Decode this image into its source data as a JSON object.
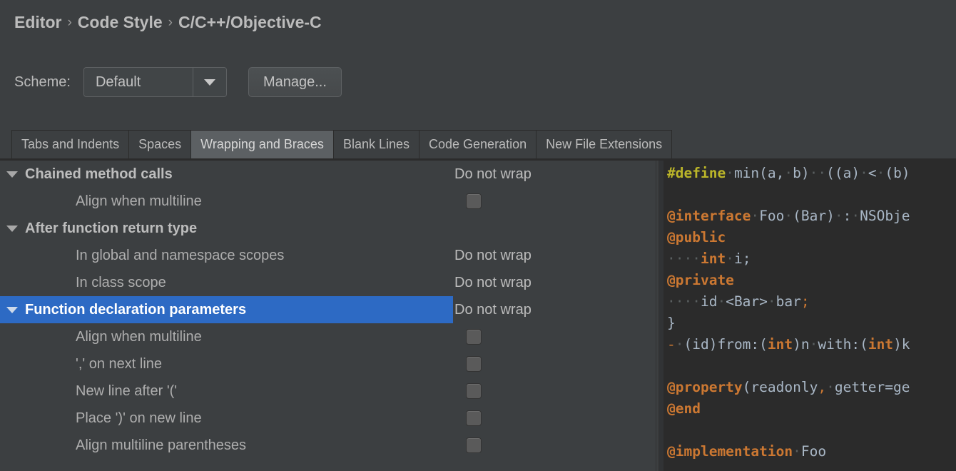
{
  "breadcrumb": {
    "items": [
      "Editor",
      "Code Style",
      "C/C++/Objective-C"
    ],
    "separator": "›"
  },
  "scheme": {
    "label": "Scheme:",
    "value": "Default",
    "options": [
      "Default"
    ],
    "manage_label": "Manage..."
  },
  "tabs": [
    {
      "label": "Tabs and Indents",
      "selected": false
    },
    {
      "label": "Spaces",
      "selected": false
    },
    {
      "label": "Wrapping and Braces",
      "selected": true
    },
    {
      "label": "Blank Lines",
      "selected": false
    },
    {
      "label": "Code Generation",
      "selected": false
    },
    {
      "label": "New File Extensions",
      "selected": false
    }
  ],
  "options": [
    {
      "label": "Chained method calls",
      "kind": "group",
      "indent": 0,
      "control": "text",
      "value": "Do not wrap",
      "selected": false,
      "expanded": true
    },
    {
      "label": "Align when multiline",
      "kind": "child",
      "indent": 1,
      "control": "checkbox",
      "checked": false,
      "selected": false
    },
    {
      "label": "After function return type",
      "kind": "group",
      "indent": 0,
      "control": "none",
      "selected": false,
      "expanded": true
    },
    {
      "label": "In global and namespace scopes",
      "kind": "child",
      "indent": 1,
      "control": "text",
      "value": "Do not wrap",
      "selected": false
    },
    {
      "label": "In class scope",
      "kind": "child",
      "indent": 1,
      "control": "text",
      "value": "Do not wrap",
      "selected": false
    },
    {
      "label": "Function declaration parameters",
      "kind": "group",
      "indent": 0,
      "control": "text",
      "value": "Do not wrap",
      "selected": true,
      "expanded": true
    },
    {
      "label": "Align when multiline",
      "kind": "child",
      "indent": 1,
      "control": "checkbox",
      "checked": false,
      "selected": false
    },
    {
      "label": "',' on next line",
      "kind": "child",
      "indent": 1,
      "control": "checkbox",
      "checked": false,
      "selected": false
    },
    {
      "label": "New line after '('",
      "kind": "child",
      "indent": 1,
      "control": "checkbox",
      "checked": false,
      "selected": false
    },
    {
      "label": "Place ')' on new line",
      "kind": "child",
      "indent": 1,
      "control": "checkbox",
      "checked": false,
      "selected": false
    },
    {
      "label": "Align multiline parentheses",
      "kind": "child",
      "indent": 1,
      "control": "checkbox",
      "checked": false,
      "selected": false
    }
  ],
  "preview": {
    "language": "Objective-C",
    "lines": [
      [
        {
          "t": "#define",
          "c": "macro"
        },
        {
          "t": "·",
          "c": "ws"
        },
        {
          "t": "min(a,",
          "c": "ident"
        },
        {
          "t": "·",
          "c": "ws"
        },
        {
          "t": "b)",
          "c": "ident"
        },
        {
          "t": "··",
          "c": "ws"
        },
        {
          "t": "((a)",
          "c": "ident"
        },
        {
          "t": "·",
          "c": "ws"
        },
        {
          "t": "<",
          "c": "ident"
        },
        {
          "t": "·",
          "c": "ws"
        },
        {
          "t": "(b)",
          "c": "ident"
        }
      ],
      [],
      [
        {
          "t": "@interface",
          "c": "kw"
        },
        {
          "t": "·",
          "c": "ws"
        },
        {
          "t": "Foo",
          "c": "ident"
        },
        {
          "t": "·",
          "c": "ws"
        },
        {
          "t": "(Bar)",
          "c": "ident"
        },
        {
          "t": "·",
          "c": "ws"
        },
        {
          "t": ":",
          "c": "ident"
        },
        {
          "t": "·",
          "c": "ws"
        },
        {
          "t": "NSObje",
          "c": "ident"
        }
      ],
      [
        {
          "t": "@public",
          "c": "kw"
        }
      ],
      [
        {
          "t": "····",
          "c": "ws"
        },
        {
          "t": "int",
          "c": "kw"
        },
        {
          "t": "·",
          "c": "ws"
        },
        {
          "t": "i;",
          "c": "ident"
        }
      ],
      [
        {
          "t": "@private",
          "c": "kw"
        }
      ],
      [
        {
          "t": "····",
          "c": "ws"
        },
        {
          "t": "id",
          "c": "ident"
        },
        {
          "t": "·",
          "c": "ws"
        },
        {
          "t": "<Bar>",
          "c": "ident"
        },
        {
          "t": "·",
          "c": "ws"
        },
        {
          "t": "bar",
          "c": "ident"
        },
        {
          "t": ";",
          "c": "op"
        }
      ],
      [
        {
          "t": "}",
          "c": "ident"
        }
      ],
      [
        {
          "t": "-",
          "c": "op"
        },
        {
          "t": "·",
          "c": "ws"
        },
        {
          "t": "(id)from:(",
          "c": "ident"
        },
        {
          "t": "int",
          "c": "kw"
        },
        {
          "t": ")n",
          "c": "ident"
        },
        {
          "t": "·",
          "c": "ws"
        },
        {
          "t": "with:(",
          "c": "ident"
        },
        {
          "t": "int",
          "c": "kw"
        },
        {
          "t": ")k",
          "c": "ident"
        }
      ],
      [],
      [
        {
          "t": "@property",
          "c": "kw"
        },
        {
          "t": "(readonly",
          "c": "ident"
        },
        {
          "t": ",",
          "c": "op"
        },
        {
          "t": "·",
          "c": "ws"
        },
        {
          "t": "getter=ge",
          "c": "ident"
        }
      ],
      [
        {
          "t": "@end",
          "c": "kw"
        }
      ],
      [],
      [
        {
          "t": "@implementation",
          "c": "kw"
        },
        {
          "t": "·",
          "c": "ws"
        },
        {
          "t": "Foo",
          "c": "ident"
        }
      ]
    ]
  },
  "colors": {
    "window_bg": "#3c3f41",
    "selection_blue": "#2d6ac4",
    "code_bg": "#2b2b2b",
    "keyword_orange": "#cc7832",
    "macro_yellow": "#bbb529",
    "identifier": "#a9b7c6",
    "tab_selected_bg": "#5c6063"
  }
}
